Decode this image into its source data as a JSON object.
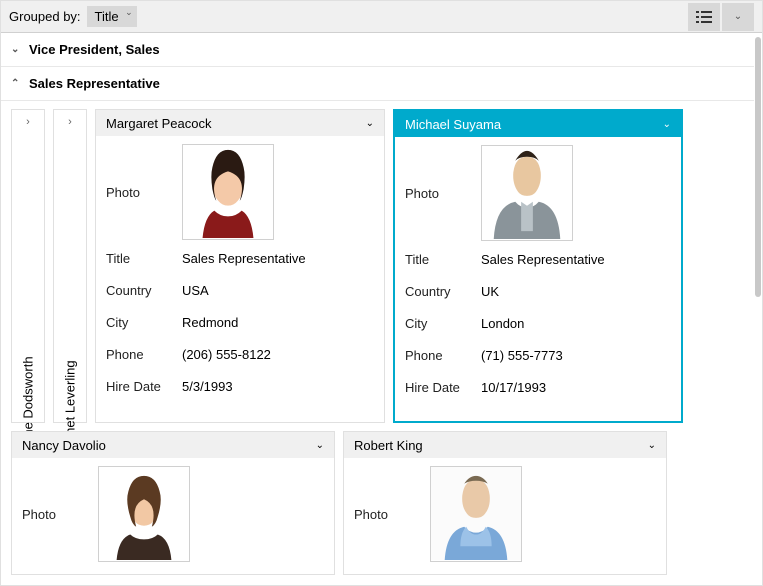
{
  "toolbar": {
    "groupedByLabel": "Grouped by:",
    "groupedByValue": "Title"
  },
  "groups": {
    "g1": {
      "label": "Vice President, Sales",
      "expanded": false
    },
    "g2": {
      "label": "Sales Representative",
      "expanded": true
    }
  },
  "collapsed": {
    "c1": "Anne Dodsworth",
    "c2": "Janet Leverling"
  },
  "fieldLabels": {
    "photo": "Photo",
    "title": "Title",
    "country": "Country",
    "city": "City",
    "phone": "Phone",
    "hireDate": "Hire Date"
  },
  "cards": {
    "margaret": {
      "name": "Margaret Peacock",
      "title": "Sales Representative",
      "country": "USA",
      "city": "Redmond",
      "phone": "(206) 555-8122",
      "hireDate": "5/3/1993"
    },
    "michael": {
      "name": "Michael Suyama",
      "title": "Sales Representative",
      "country": "UK",
      "city": "London",
      "phone": "(71) 555-7773",
      "hireDate": "10/17/1993"
    },
    "nancy": {
      "name": "Nancy Davolio"
    },
    "robert": {
      "name": "Robert King"
    }
  }
}
